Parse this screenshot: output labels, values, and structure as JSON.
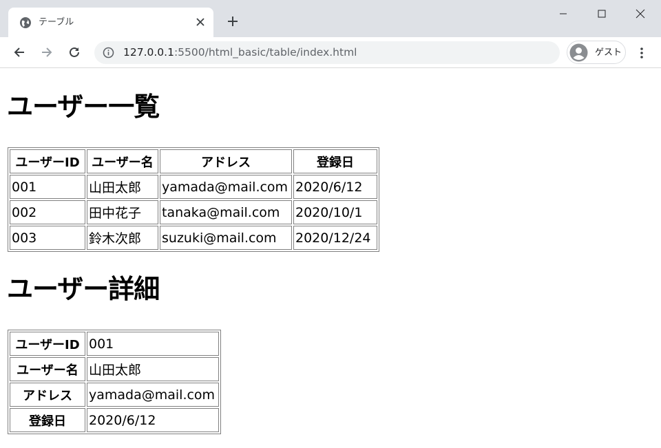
{
  "browser": {
    "tab_title": "テーブル",
    "url_host": "127.0.0.1",
    "url_rest": ":5500/html_basic/table/index.html",
    "profile_label": "ゲスト",
    "icons": {
      "favicon": "globe-icon",
      "tab_close": "close-icon",
      "new_tab": "plus-icon",
      "back": "arrow-left-icon",
      "forward": "arrow-right-icon",
      "reload": "reload-icon",
      "site_info": "info-icon",
      "profile": "avatar-icon",
      "menu": "kebab-menu-icon",
      "minimize": "minimize-icon",
      "maximize": "maximize-icon",
      "close_window": "close-icon"
    }
  },
  "page": {
    "list_heading": "ユーザー一覧",
    "detail_heading": "ユーザー詳細",
    "list_table": {
      "headers": [
        "ユーザーID",
        "ユーザー名",
        "アドレス",
        "登録日"
      ],
      "rows": [
        [
          "001",
          "山田太郎",
          "yamada@mail.com",
          "2020/6/12"
        ],
        [
          "002",
          "田中花子",
          "tanaka@mail.com",
          "2020/10/1"
        ],
        [
          "003",
          "鈴木次郎",
          "suzuki@mail.com",
          "2020/12/24"
        ]
      ]
    },
    "detail_table": {
      "rows": [
        {
          "label": "ユーザーID",
          "value": "001"
        },
        {
          "label": "ユーザー名",
          "value": "山田太郎"
        },
        {
          "label": "アドレス",
          "value": "yamada@mail.com"
        },
        {
          "label": "登録日",
          "value": "2020/6/12"
        }
      ]
    }
  }
}
